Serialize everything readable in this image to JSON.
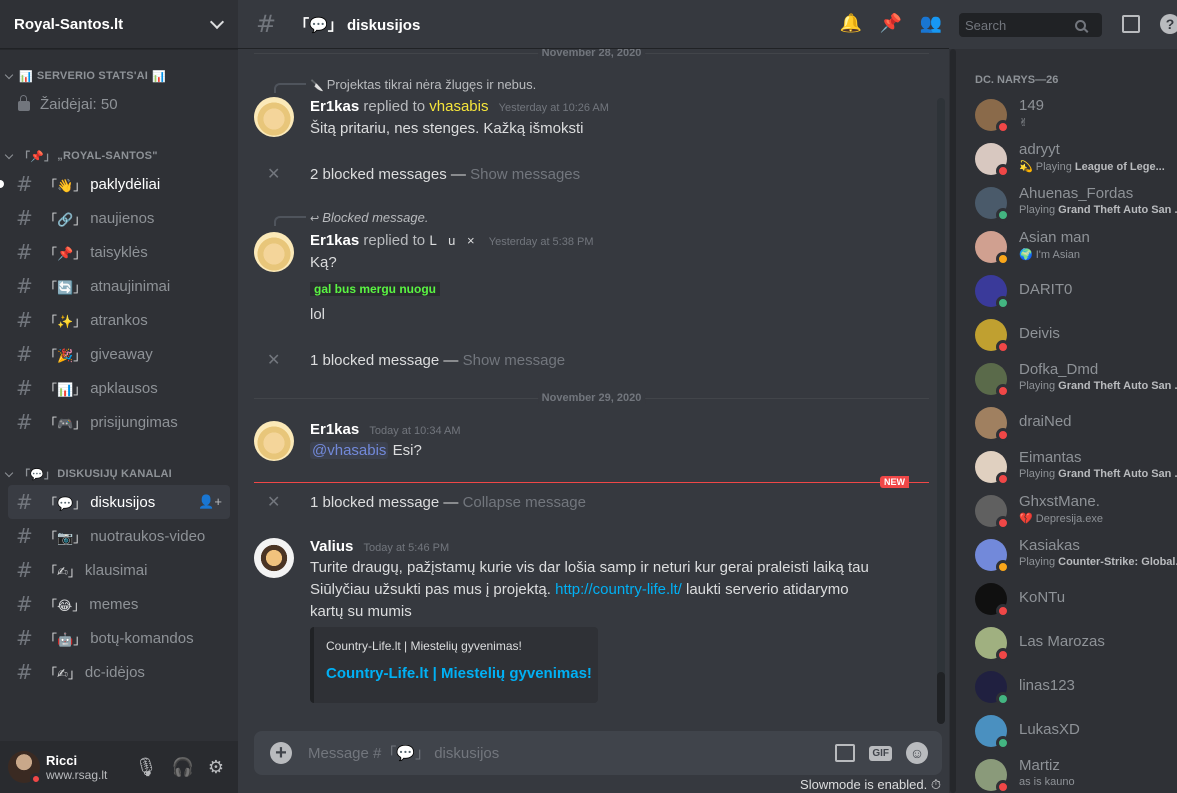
{
  "server": {
    "name": "Royal-Santos.lt"
  },
  "categories": {
    "stats": "SERVERIO STATS'AI",
    "royal": "„ROYAL-SANTOS\"",
    "kanalai": "DISKUSIJŲ KANALAI"
  },
  "stats_channel": {
    "label": "Žaidėjai: 50"
  },
  "channels": [
    {
      "emoji": "「👋」",
      "name": "paklydėliai",
      "unread": true
    },
    {
      "emoji": "「🔗」",
      "name": "naujienos"
    },
    {
      "emoji": "「📌」",
      "name": "taisyklės"
    },
    {
      "emoji": "「🔄」",
      "name": "atnaujinimai"
    },
    {
      "emoji": "「✨」",
      "name": "atrankos"
    },
    {
      "emoji": "「🎉」",
      "name": "giveaway"
    },
    {
      "emoji": "「📊」",
      "name": "apklausos"
    },
    {
      "emoji": "「🎮」",
      "name": "prisijungimas"
    }
  ],
  "discussion_channels": [
    {
      "emoji": "「💬」",
      "name": "diskusijos",
      "active": true
    },
    {
      "emoji": "「📷」",
      "name": "nuotraukos-video"
    },
    {
      "emoji": "「✍」",
      "name": "klausimai"
    },
    {
      "emoji": "「😂」",
      "name": "memes"
    },
    {
      "emoji": "「🤖」",
      "name": "botų-komandos"
    },
    {
      "emoji": "「✍」",
      "name": "dc-idėjos"
    }
  ],
  "user": {
    "name": "Ricci",
    "tag": "www.rsag.lt"
  },
  "topbar": {
    "channel": "「💬」 diskusijos",
    "search_placeholder": "Search"
  },
  "dates": {
    "d1": "November 28, 2020",
    "d2": "November 29, 2020"
  },
  "messages": {
    "m1_reply": "Projektas tikrai nėra žlugęs ir nebus.",
    "m1_user": "Er1kas",
    "m1_replied": "replied to",
    "m1_target": "vhasabis",
    "m1_time": "Yesterday at 10:26 AM",
    "m1_text": "Šitą pritariu, nes stenges. Kažką išmoksti",
    "b1_text": "2 blocked messages —",
    "b1_link": "Show messages",
    "m2_reply": "Blocked message.",
    "m2_user": "Er1kas",
    "m2_replied": "replied to",
    "m2_target": "ᒪ u ×",
    "m2_time": "Yesterday at 5:38 PM",
    "m2_text1": "Ką?",
    "m2_green": "gal bus mergu nuogu",
    "m2_text2": "lol",
    "b2_text": "1 blocked message —",
    "b2_link": "Show message",
    "m3_user": "Er1kas",
    "m3_time": "Today at 10:34 AM",
    "m3_mention": "@vhasabis",
    "m3_text": "Esi?",
    "new_badge": "NEW",
    "b3_text": "1 blocked message —",
    "b3_link": "Collapse message",
    "m4_user": "Valius",
    "m4_time": "Today at 5:46 PM",
    "m4_line1": "Turite draugų, pažįstamų kurie vis dar lošia samp ir neturi kur gerai praleisti laiką tau",
    "m4_line2a": "Siūlyčiau užsukti pas mus į projektą.",
    "m4_link": "http://country-life.lt/",
    "m4_line2b": "laukti serverio atidarymo",
    "m4_line3": "kartų su mumis",
    "embed_provider": "Country-Life.lt | Miestelių gyvenimas!",
    "embed_title": "Country-Life.lt | Miestelių gyvenimas!"
  },
  "composer": {
    "placeholder": "Message #「💬」 diskusijos",
    "slowmode": "Slowmode is enabled."
  },
  "members_header": "DC. NARYS—26",
  "members": [
    {
      "name": "149",
      "activity": "✌",
      "status": "dnd",
      "color": "#8a6a4a"
    },
    {
      "name": "adryyt",
      "activity_pre": "💫 Playing",
      "activity_game": "League of Lege...",
      "status": "dnd",
      "color": "#d8c8c0"
    },
    {
      "name": "Ahuenas_Fordas",
      "activity_pre": "Playing",
      "activity_game": "Grand Theft Auto San ...",
      "status": "online",
      "color": "#4a5a6a"
    },
    {
      "name": "Asian man",
      "activity": "🌍 I'm Asian",
      "status": "idle",
      "color": "#d0a090"
    },
    {
      "name": "DARIT0",
      "status": "online",
      "color": "#3a3a9a"
    },
    {
      "name": "Deivis",
      "status": "dnd",
      "color": "#c0a030"
    },
    {
      "name": "Dofka_Dmd",
      "activity_pre": "Playing",
      "activity_game": "Grand Theft Auto San ...",
      "status": "dnd",
      "color": "#5a6a4a"
    },
    {
      "name": "draiNed",
      "status": "dnd",
      "color": "#a08060"
    },
    {
      "name": "Eimantas",
      "activity_pre": "Playing",
      "activity_game": "Grand Theft Auto San ...",
      "status": "dnd",
      "color": "#e0d0c0"
    },
    {
      "name": "GhxstMane.",
      "activity": "💔 Depresija.exe",
      "status": "dnd",
      "color": "#606060"
    },
    {
      "name": "Kasiakas",
      "activity_pre": "Playing",
      "activity_game": "Counter-Strike: Global...",
      "status": "idle",
      "color": "#7289da"
    },
    {
      "name": "KoNTu",
      "status": "dnd",
      "color": "#101010"
    },
    {
      "name": "Las Marozas",
      "status": "dnd",
      "color": "#a0b080"
    },
    {
      "name": "linas123",
      "status": "online",
      "color": "#202040"
    },
    {
      "name": "LukasXD",
      "status": "mobile",
      "color": "#4a90c0"
    },
    {
      "name": "Martiz",
      "activity": "as is kauno",
      "status": "dnd",
      "color": "#8a9a7a"
    }
  ]
}
